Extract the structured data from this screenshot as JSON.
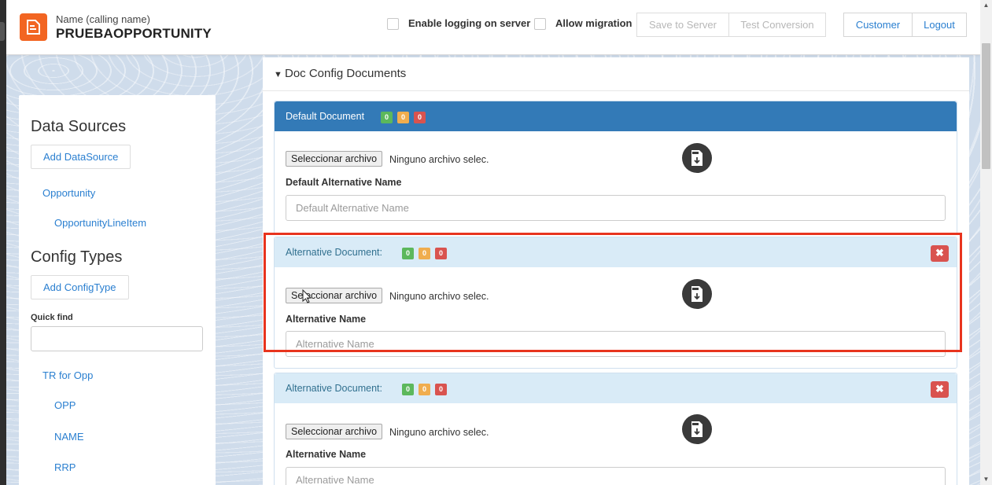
{
  "header": {
    "subtitle": "Name (calling name)",
    "title": "PRUEBAOPPORTUNITY",
    "enable_logging_label": "Enable logging on server",
    "allow_migration_label": "Allow migration",
    "save_to_server_label": "Save to Server",
    "test_conversion_label": "Test Conversion",
    "customer_label": "Customer",
    "logout_label": "Logout"
  },
  "sidebar": {
    "data_sources_title": "Data Sources",
    "add_datasource_label": "Add DataSource",
    "datasources": [
      "Opportunity",
      "OpportunityLineItem"
    ],
    "config_types_title": "Config Types",
    "add_configtype_label": "Add ConfigType",
    "quick_find_label": "Quick find",
    "quick_find_value": "",
    "config_tree": [
      "TR for Opp",
      "OPP",
      "NAME",
      "RRP"
    ]
  },
  "main": {
    "section_title": "Doc Config Documents",
    "documents": [
      {
        "title": "Default Document",
        "badges": [
          "0",
          "0",
          "0"
        ],
        "file_button": "Seleccionar archivo",
        "file_status": "Ninguno archivo selec.",
        "field_label": "Default Alternative Name",
        "field_placeholder": "Default Alternative Name",
        "field_value": ""
      },
      {
        "title": "Alternative Document:",
        "badges": [
          "0",
          "0",
          "0"
        ],
        "file_button": "Seleccionar archivo",
        "file_status": "Ninguno archivo selec.",
        "field_label": "Alternative Name",
        "field_placeholder": "Alternative Name",
        "field_value": ""
      },
      {
        "title": "Alternative Document:",
        "badges": [
          "0",
          "0",
          "0"
        ],
        "file_button": "Seleccionar archivo",
        "file_status": "Ninguno archivo selec.",
        "field_label": "Alternative Name",
        "field_placeholder": "Alternative Name",
        "field_value": ""
      }
    ]
  },
  "icons": {
    "logo": "document-logo-icon",
    "doc": "doc-download-icon",
    "delete": "close-icon",
    "caret": "chevron-down-icon"
  },
  "colors": {
    "primary": "#337ab7",
    "brand": "#f26522",
    "link": "#2a7fd0",
    "danger": "#d9534f",
    "success": "#5cb85c",
    "warning": "#f0ad4e",
    "highlight": "#e8341e"
  }
}
